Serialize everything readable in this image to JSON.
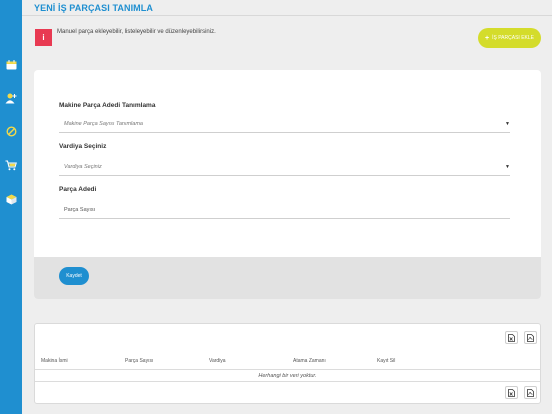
{
  "header": {
    "title": "YENİ İŞ PARÇASI TANIMLA",
    "info_text": "Manuel parça ekleyebilir, listeleyebilir ve düzenleyebilirsiniz.",
    "add_button_label": "İŞ PARÇASI EKLE"
  },
  "sidebar": {
    "icons": [
      "calendar-icon",
      "user-add-icon",
      "block-icon",
      "shopping-cart-icon",
      "box-icon"
    ]
  },
  "form": {
    "fields": [
      {
        "label": "Makine Parça Adedi Tanımlama",
        "placeholder": "Makine Parça Sayısı Tanımlama"
      },
      {
        "label": "Vardiya Seçiniz",
        "placeholder": "Vardiya Seçiniz"
      },
      {
        "label": "Parça Adedi",
        "placeholder": "Parça Sayısı"
      }
    ],
    "save_label": "Kaydet"
  },
  "table": {
    "columns": [
      "Makina İsmi",
      "Parça Sayısı",
      "Vardiya",
      "Atama Zamanı",
      "Kayıt Sil"
    ],
    "empty_text": "Herhangi bir veri yoktur."
  },
  "colors": {
    "primary": "#1f8fd0",
    "accent": "#d4dc2b",
    "alert": "#e83a52"
  }
}
